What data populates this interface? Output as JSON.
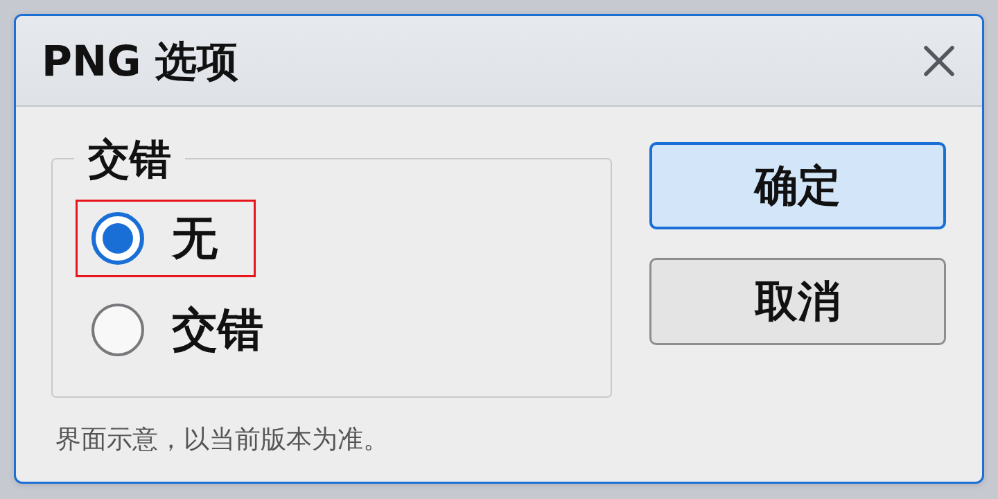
{
  "window": {
    "title": "PNG 选项"
  },
  "interlace": {
    "legend": "交错",
    "options": [
      {
        "label": "无",
        "selected": true,
        "highlighted": true
      },
      {
        "label": "交错",
        "selected": false,
        "highlighted": false
      }
    ]
  },
  "buttons": [
    {
      "label": "确定",
      "kind": "confirm"
    },
    {
      "label": "取消",
      "kind": "cancel"
    }
  ],
  "note": "界面示意，以当前版本为准。"
}
